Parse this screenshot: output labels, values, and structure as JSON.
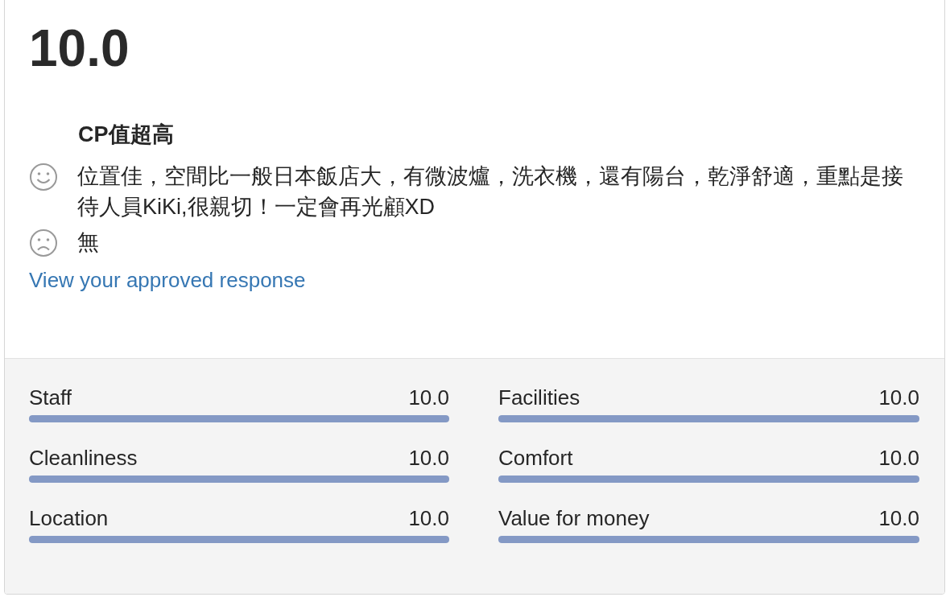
{
  "score": "10.0",
  "review": {
    "title": "CP值超高",
    "comments": [
      {
        "kind": "positive",
        "text": "位置佳，空間比一般日本飯店大，有微波爐，洗衣機，還有陽台，乾淨舒適，重點是接待人員KiKi,很親切！一定會再光顧XD"
      },
      {
        "kind": "negative",
        "text": "無"
      }
    ],
    "link": "View your approved response"
  },
  "categories": [
    {
      "name": "Staff",
      "score": "10.0",
      "level": 1
    },
    {
      "name": "Facilities",
      "score": "10.0",
      "level": 1
    },
    {
      "name": "Cleanliness",
      "score": "10.0",
      "level": 1
    },
    {
      "name": "Comfort",
      "score": "10.0",
      "level": 1
    },
    {
      "name": "Location",
      "score": "10.0",
      "level": 1
    },
    {
      "name": "Value for money",
      "score": "10.0",
      "level": 1
    }
  ]
}
